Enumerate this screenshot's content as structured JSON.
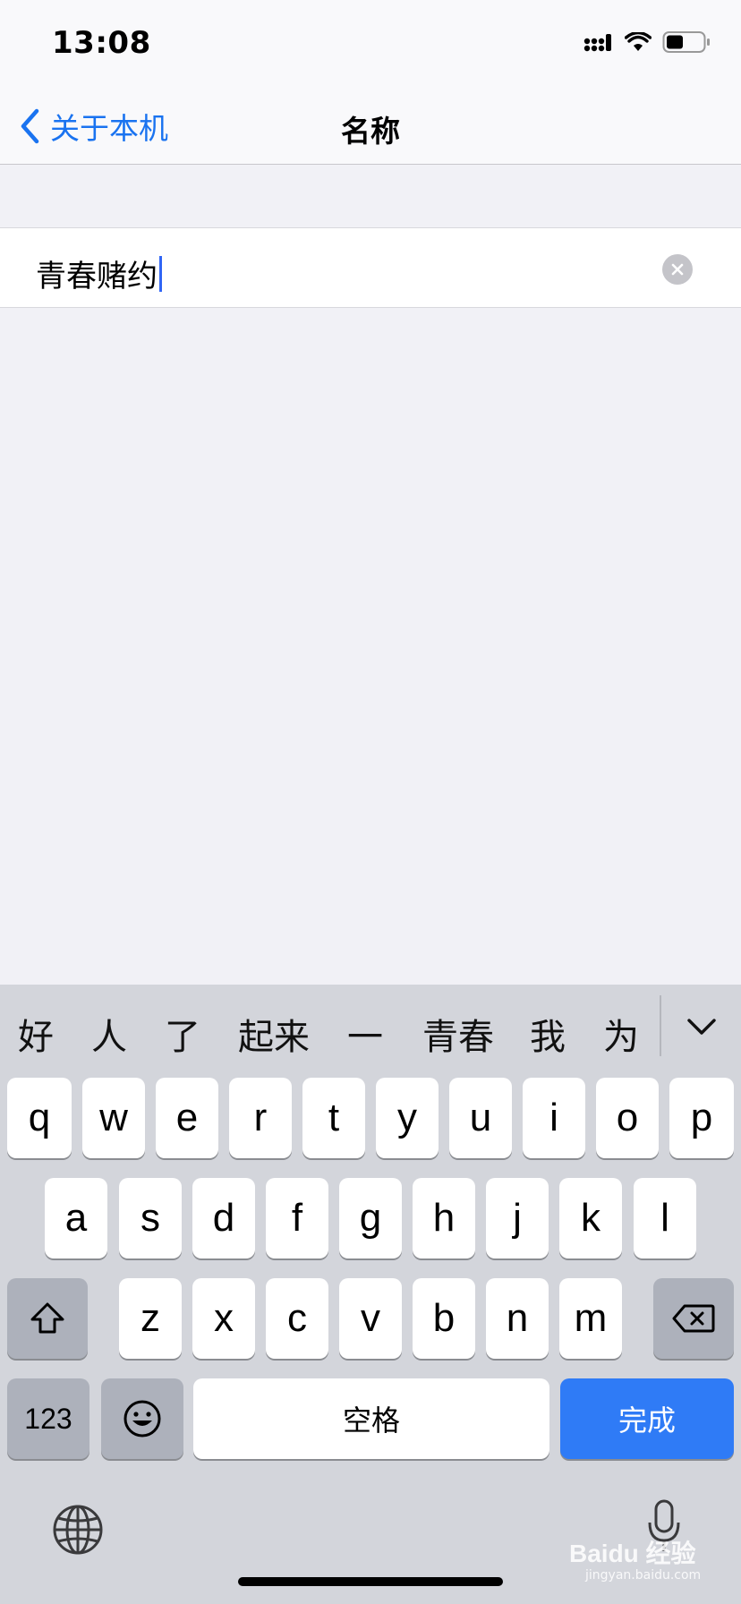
{
  "status_bar": {
    "time": "13:08"
  },
  "nav": {
    "back_label": "关于本机",
    "title": "名称"
  },
  "name_field": {
    "value": "青春赌约"
  },
  "keyboard": {
    "candidates": [
      "好",
      "人",
      "了",
      "起来",
      "一",
      "青春",
      "我",
      "为"
    ],
    "row1": [
      "q",
      "w",
      "e",
      "r",
      "t",
      "y",
      "u",
      "i",
      "o",
      "p"
    ],
    "row2": [
      "a",
      "s",
      "d",
      "f",
      "g",
      "h",
      "j",
      "k",
      "l"
    ],
    "row3": [
      "z",
      "x",
      "c",
      "v",
      "b",
      "n",
      "m"
    ],
    "num_label": "123",
    "space_label": "空格",
    "done_label": "完成"
  },
  "watermark": {
    "main": "Baidu 经验",
    "sub": "jingyan.baidu.com"
  },
  "colors": {
    "accent": "#1a73f0",
    "done": "#2f7bf6"
  }
}
